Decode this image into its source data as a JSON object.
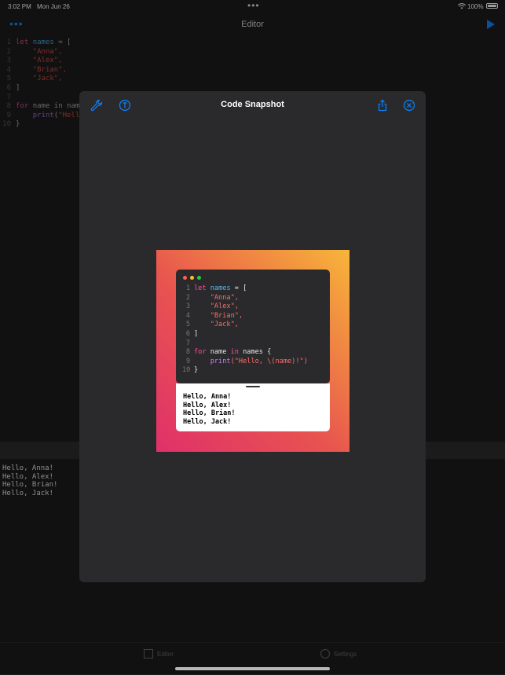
{
  "status_bar": {
    "time": "3:02 PM",
    "date": "Mon Jun 26",
    "multitask": "•••",
    "battery": "100%"
  },
  "nav": {
    "more": "•••",
    "title": "Editor"
  },
  "editor": {
    "line_numbers": [
      "1",
      "2",
      "3",
      "4",
      "5",
      "6",
      "7",
      "8",
      "9",
      "10"
    ],
    "partial_line8": "name in nam",
    "partial_line9": "\"Hell"
  },
  "console": {
    "output": [
      "Hello, Anna!",
      "Hello, Alex!",
      "Hello, Brian!",
      "Hello, Jack!"
    ]
  },
  "tabs": {
    "editor": "Editor",
    "settings": "Settings"
  },
  "modal": {
    "title": "Code Snapshot",
    "icons": [
      "wrench-icon",
      "text-format-icon",
      "share-icon",
      "close-icon"
    ]
  },
  "snapshot": {
    "code": {
      "let": "let",
      "names": "names",
      "eq": " = [",
      "anna": "\"Anna\",",
      "alex": "\"Alex\",",
      "brian": "\"Brian\",",
      "jack": "\"Jack\",",
      "close_bracket": "]",
      "for": "for",
      "name": " name ",
      "in": "in",
      "names_brace": " names {",
      "print": "print",
      "print_arg": "(\"Hello, \\(name)!\")",
      "close_brace": "}"
    },
    "output": [
      "Hello, Anna!",
      "Hello, Alex!",
      "Hello, Brian!",
      "Hello, Jack!"
    ]
  },
  "colors": {
    "accent": "#0a84ff",
    "gradient_start": "#e0306a",
    "gradient_end": "#f8b63a"
  }
}
